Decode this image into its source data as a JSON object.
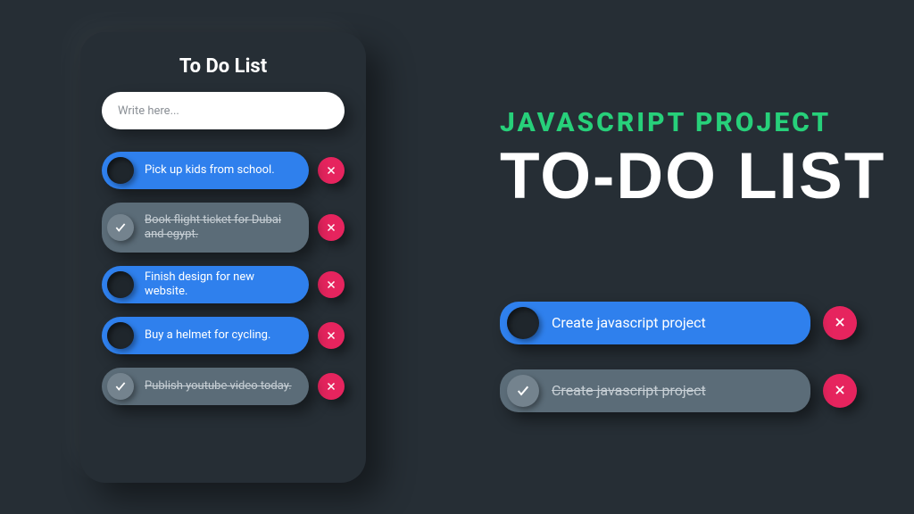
{
  "panel": {
    "title": "To Do List",
    "input_placeholder": "Write here..."
  },
  "items": [
    {
      "text": "Pick up kids from school.",
      "done": false
    },
    {
      "text": "Book flight ticket for Dubai and egypt.",
      "done": true,
      "tall": true
    },
    {
      "text": "Finish design for new website.",
      "done": false
    },
    {
      "text": "Buy a helmet for cycling.",
      "done": false
    },
    {
      "text": "Publish youtube video today.",
      "done": true
    }
  ],
  "headline": {
    "subtitle": "JAVASCRIPT PROJECT",
    "title": "TO-DO LIST"
  },
  "demo_items": [
    {
      "text": "Create javascript project",
      "done": false
    },
    {
      "text": "Create javascript project",
      "done": true
    }
  ],
  "colors": {
    "bg": "#262e35",
    "active": "#2f80ed",
    "done_bg": "#5b6c78",
    "delete": "#e6245e",
    "accent_green": "#27d07a"
  }
}
